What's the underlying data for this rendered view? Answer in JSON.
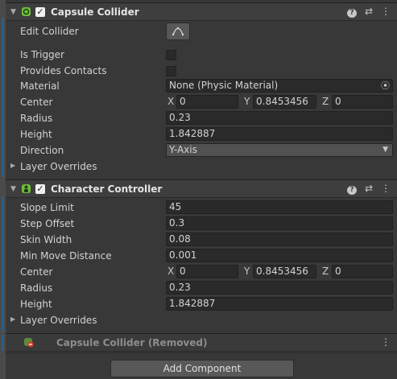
{
  "capsule": {
    "title": "Capsule Collider",
    "fields": {
      "edit_collider": "Edit Collider",
      "is_trigger": "Is Trigger",
      "provides_contacts": "Provides Contacts",
      "material_label": "Material",
      "material_value": "None (Physic Material)",
      "center_label": "Center",
      "center_x": "0",
      "center_y": "0.8453456",
      "center_z": "0",
      "radius_label": "Radius",
      "radius_value": "0.23",
      "height_label": "Height",
      "height_value": "1.842887",
      "direction_label": "Direction",
      "direction_value": "Y-Axis",
      "layer_overrides": "Layer Overrides"
    }
  },
  "character": {
    "title": "Character Controller",
    "fields": {
      "slope_label": "Slope Limit",
      "slope_value": "45",
      "step_label": "Step Offset",
      "step_value": "0.3",
      "skin_label": "Skin Width",
      "skin_value": "0.08",
      "minmove_label": "Min Move Distance",
      "minmove_value": "0.001",
      "center_label": "Center",
      "center_x": "0",
      "center_y": "0.8453456",
      "center_z": "0",
      "radius_label": "Radius",
      "radius_value": "0.23",
      "height_label": "Height",
      "height_value": "1.842887",
      "layer_overrides": "Layer Overrides"
    }
  },
  "removed": {
    "title": "Capsule Collider (Removed)"
  },
  "axes": {
    "x": "X",
    "y": "Y",
    "z": "Z"
  },
  "add_component": "Add Component",
  "icons": {
    "capsule": "capsule-collider-icon",
    "character": "character-controller-icon",
    "help": "help-icon",
    "presets": "presets-icon",
    "menu": "kebab-menu-icon"
  }
}
